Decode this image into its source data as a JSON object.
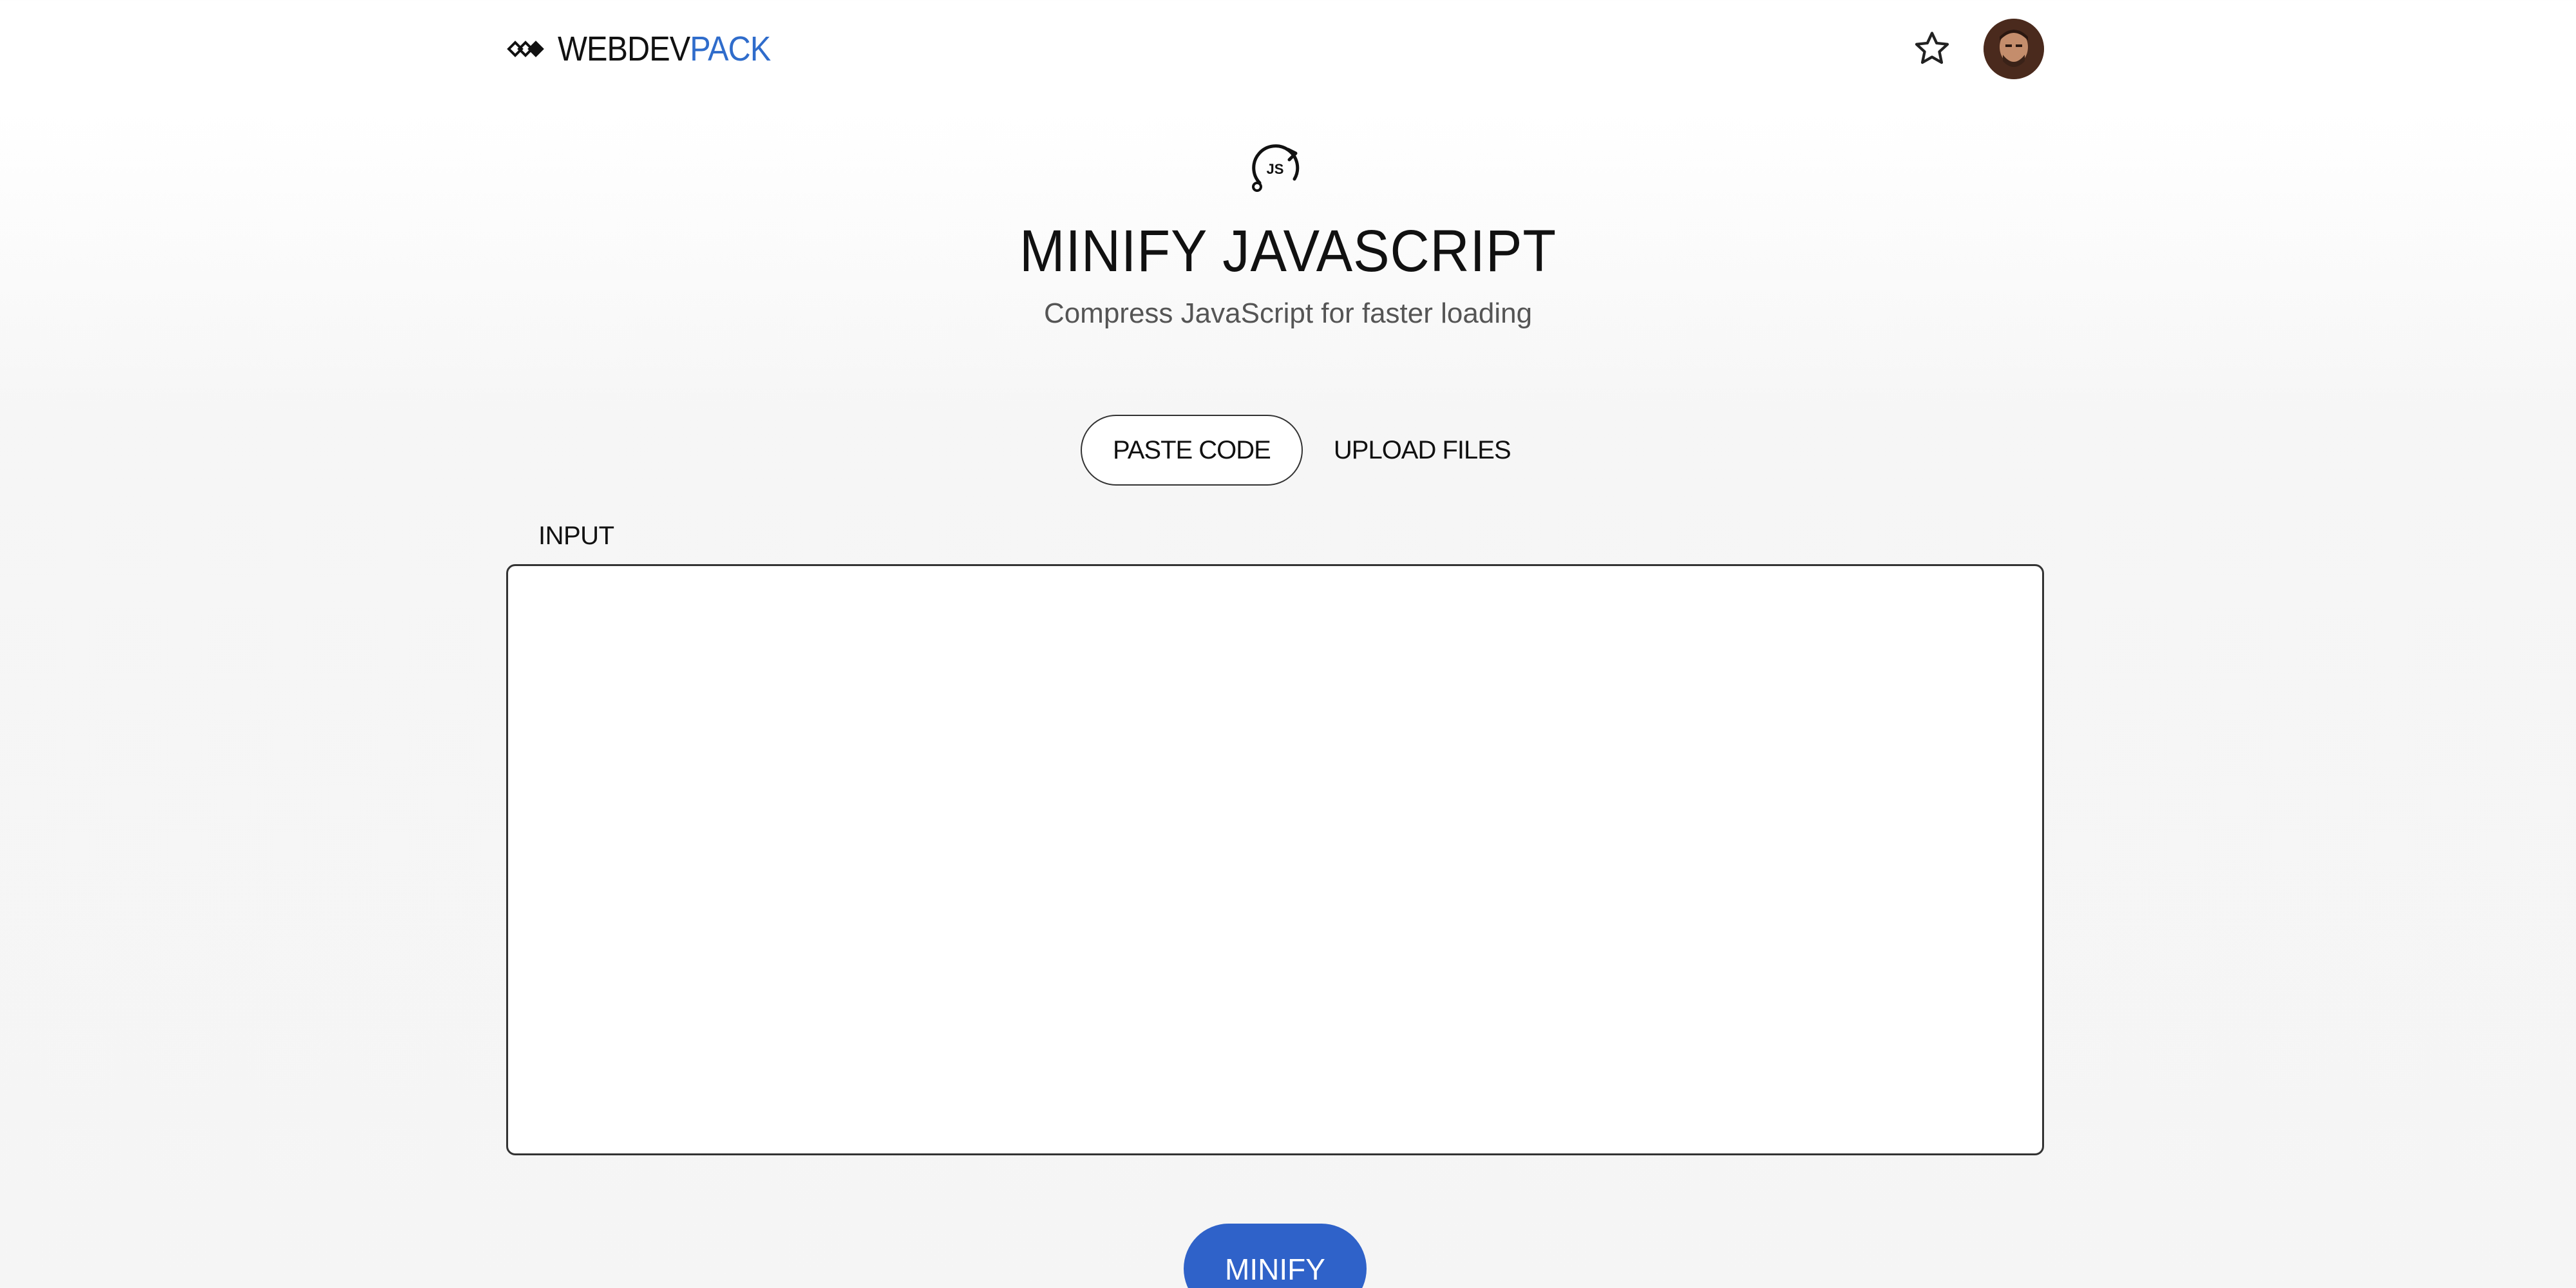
{
  "header": {
    "logo_part1": "WEBDEV",
    "logo_part2": "PACK",
    "logo_icon": "diamond-chevrons-icon",
    "favorite_icon": "star-icon",
    "avatar_icon": "user-avatar"
  },
  "hero": {
    "icon": "js-refresh-icon",
    "icon_text": "JS",
    "title": "MINIFY JAVASCRIPT",
    "subtitle": "Compress JavaScript for faster loading"
  },
  "tabs": [
    {
      "label": "PASTE CODE",
      "active": true
    },
    {
      "label": "UPLOAD FILES",
      "active": false
    }
  ],
  "input": {
    "label": "INPUT",
    "value": "",
    "placeholder": ""
  },
  "actions": {
    "minify_label": "MINIFY"
  },
  "colors": {
    "accent": "#2f6ccb",
    "button": "#2f62c9",
    "text": "#111111",
    "muted": "#555555"
  }
}
